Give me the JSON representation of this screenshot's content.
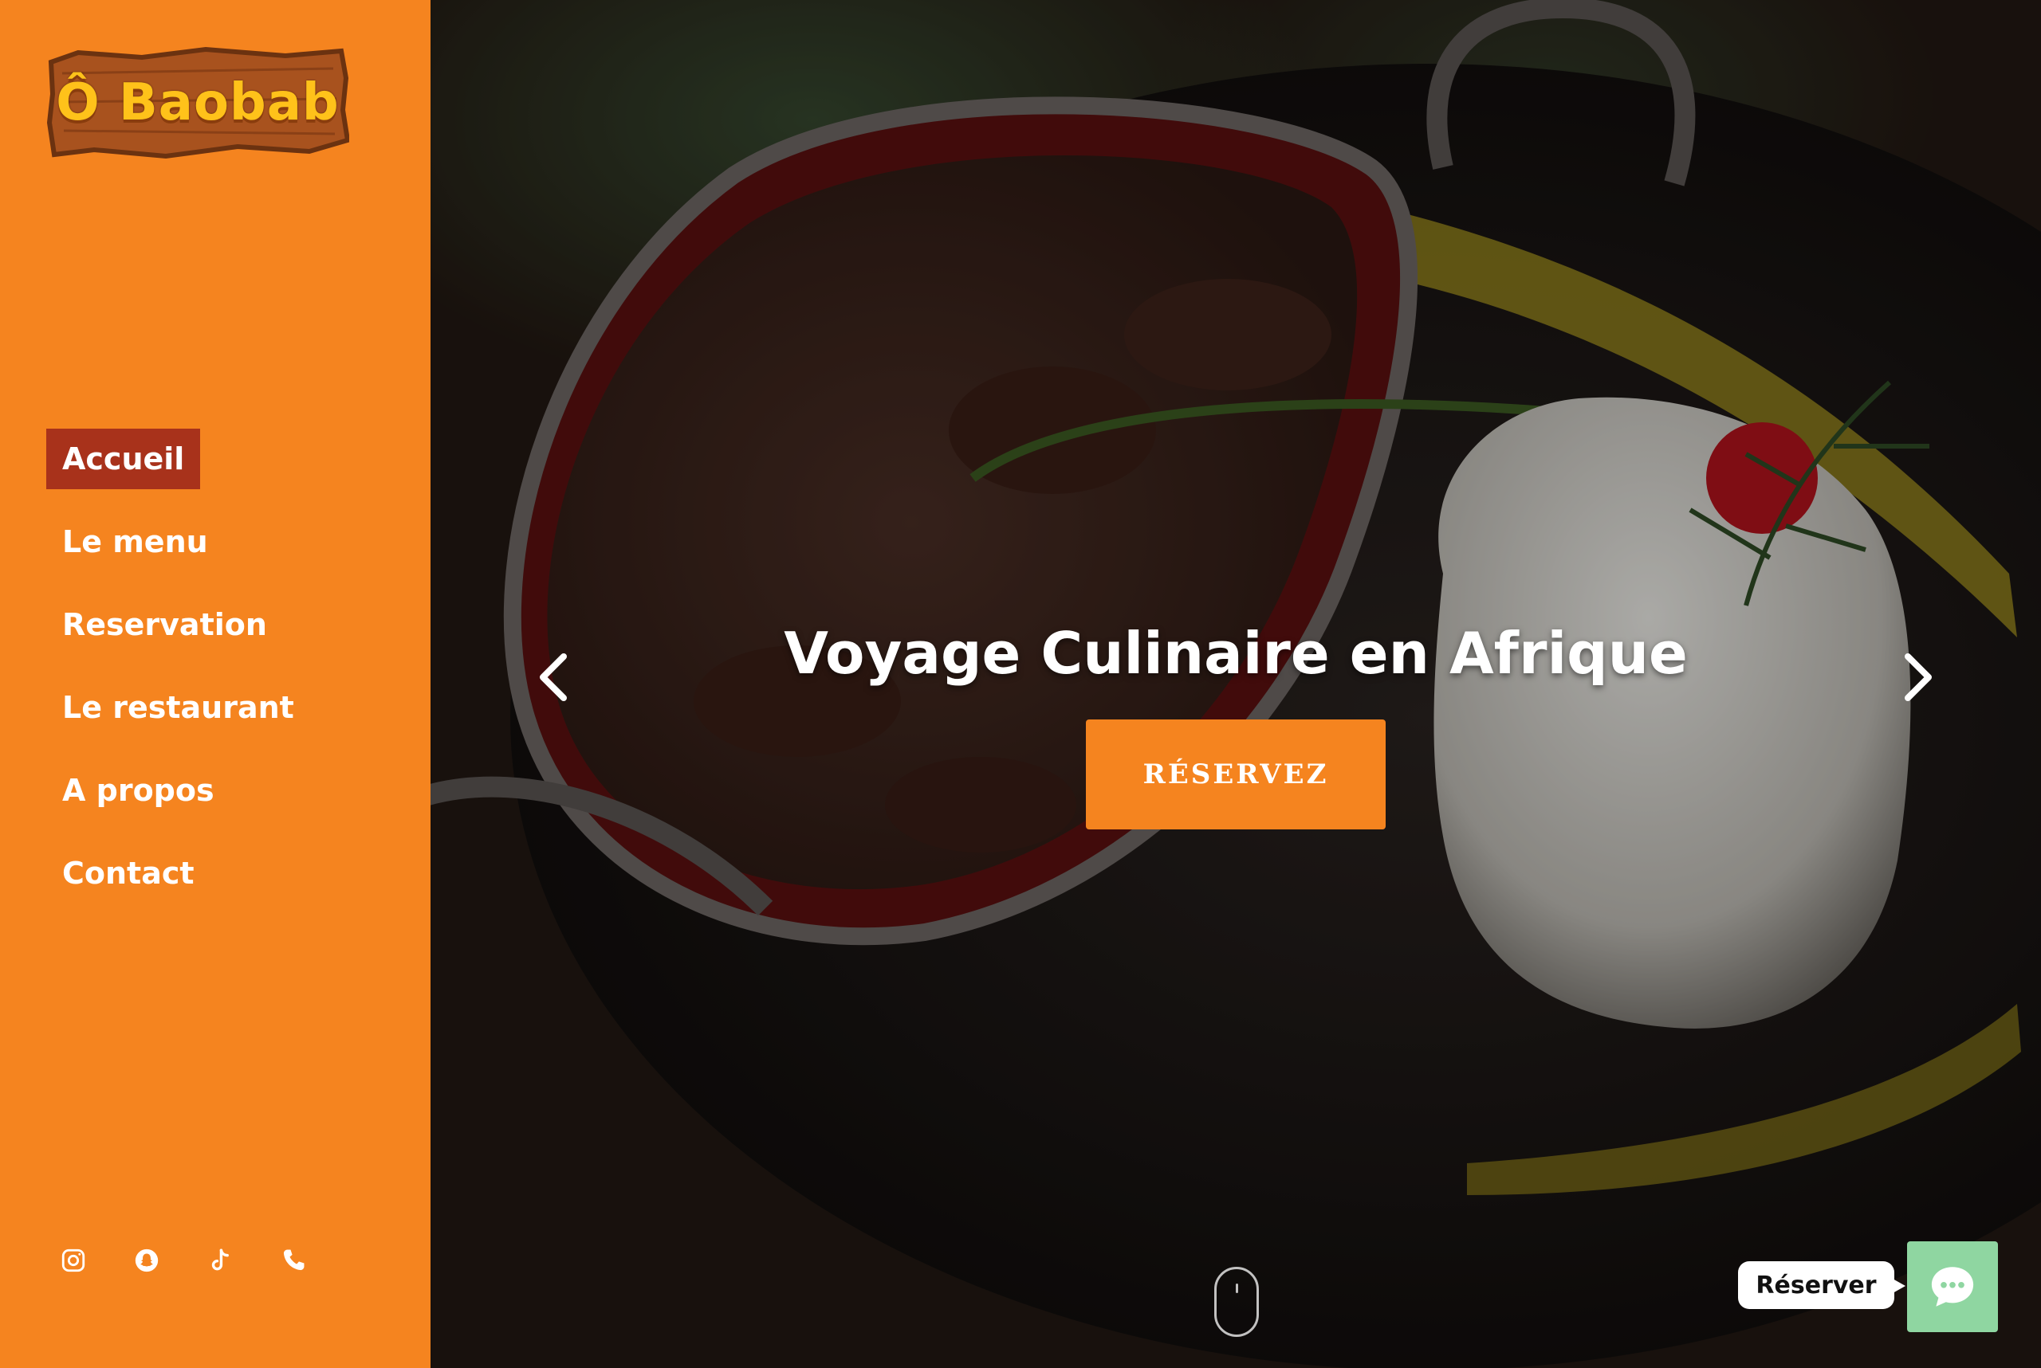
{
  "brand": {
    "logo_text": "Ô Baobab",
    "accent_color": "#f5841f",
    "active_color": "#a8321b"
  },
  "nav": {
    "items": [
      {
        "label": "Accueil",
        "active": true
      },
      {
        "label": "Le menu",
        "active": false
      },
      {
        "label": "Reservation",
        "active": false
      },
      {
        "label": "Le restaurant",
        "active": false
      },
      {
        "label": "A propos",
        "active": false
      },
      {
        "label": "Contact",
        "active": false
      }
    ]
  },
  "social": [
    {
      "icon": "instagram-icon"
    },
    {
      "icon": "snapchat-icon"
    },
    {
      "icon": "tiktok-icon"
    },
    {
      "icon": "phone-icon"
    }
  ],
  "hero": {
    "title": "Voyage Culinaire en Afrique",
    "cta_label": "RÉSERVEZ",
    "prev_icon": "chevron-left-icon",
    "next_icon": "chevron-right-icon",
    "scroll_icon": "mouse-scroll-icon"
  },
  "widget": {
    "reserve_label": "Réserver",
    "chat_icon": "chat-bubble-icon",
    "chat_color": "#8fd6a1"
  }
}
